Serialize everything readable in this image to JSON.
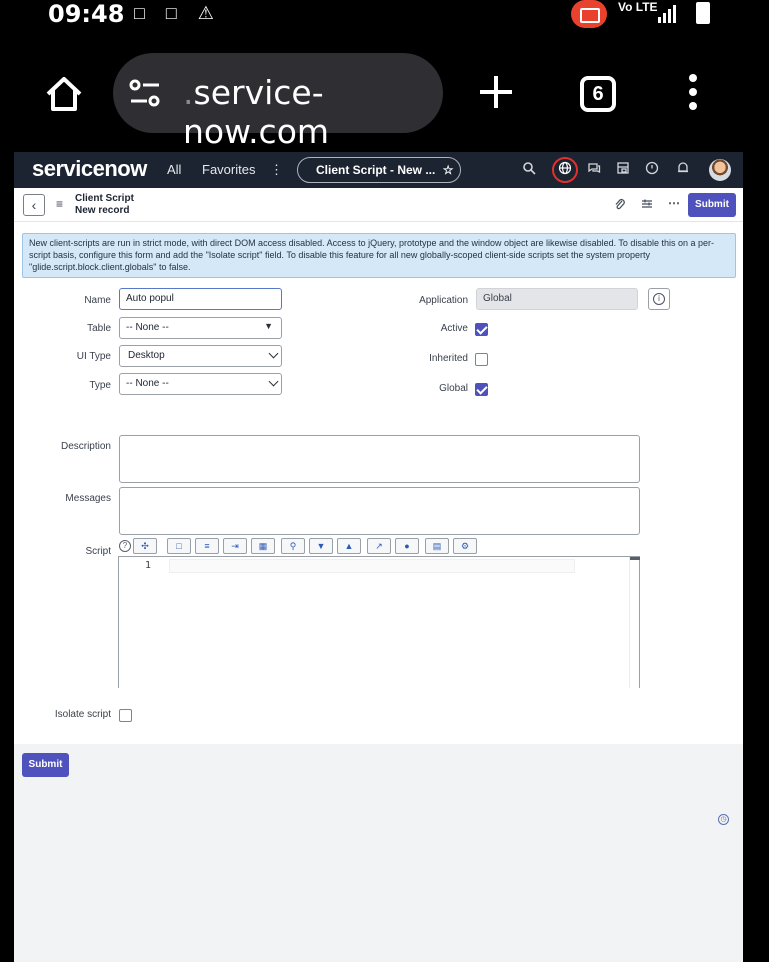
{
  "status_bar": {
    "time": "09:48",
    "left_icons": "□ □ ⚠",
    "net_label_top": "Vo LTE",
    "net_label_bottom": "LTE"
  },
  "browser": {
    "url_prefix": ".",
    "url": "service-now.com",
    "tab_count": "6"
  },
  "sn_header": {
    "logo": "servicenow",
    "nav_all": "All",
    "nav_favorites": "Favorites",
    "nav_more": "⋮",
    "context_pill": "Client Script - New ...",
    "star": "☆",
    "icons": [
      "search-icon",
      "globe-icon",
      "chat-icon",
      "app-icon",
      "help-icon",
      "bell-icon",
      "avatar"
    ]
  },
  "record": {
    "title": "Client Script",
    "subtitle": "New record",
    "submit_label": "Submit"
  },
  "info_message": "New client-scripts are run in strict mode, with direct DOM access disabled. Access to jQuery, prototype and the window object are likewise disabled. To disable this on a per-script basis, configure this form and add the \"Isolate script\" field. To disable this feature for all new globally-scoped client-side scripts set the system property \"glide.script.block.client.globals\" to false.",
  "form": {
    "name_label": "Name",
    "name_value": "Auto popul",
    "table_label": "Table",
    "table_value": "-- None --",
    "ui_type_label": "UI Type",
    "ui_type_value": "Desktop",
    "type_label": "Type",
    "type_value": "-- None --",
    "application_label": "Application",
    "application_value": "Global",
    "active_label": "Active",
    "active_checked": true,
    "inherited_label": "Inherited",
    "inherited_checked": false,
    "global_label": "Global",
    "global_checked": true,
    "description_label": "Description",
    "messages_label": "Messages",
    "script_label": "Script",
    "script_line_number": "1",
    "isolate_label": "Isolate script",
    "isolate_checked": false
  },
  "footer": {
    "submit_label": "Submit"
  },
  "colors": {
    "sn_header_bg": "#1c2331",
    "submit_bg": "#4f52bd",
    "info_bg": "#d5e8f7",
    "record_red_ring": "#e0322b"
  }
}
